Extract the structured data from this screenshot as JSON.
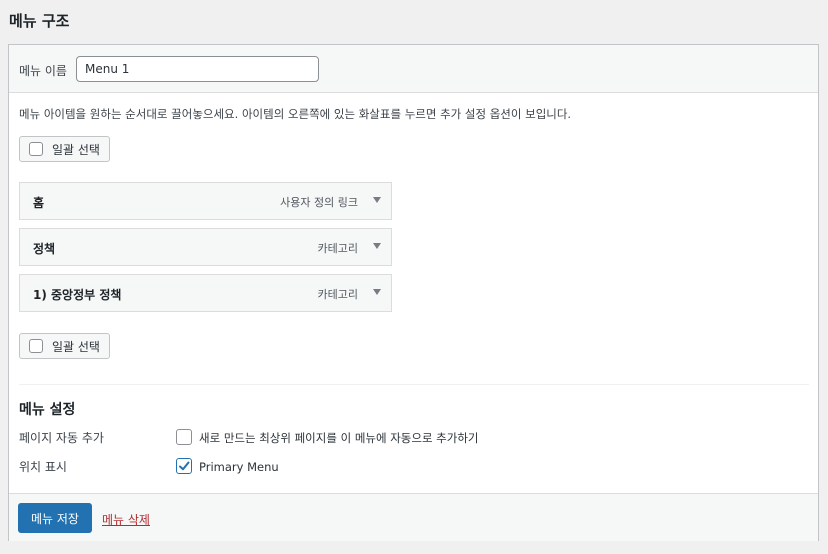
{
  "page": {
    "title": "메뉴 구조"
  },
  "menu_name": {
    "label": "메뉴 이름",
    "value": "Menu 1"
  },
  "instructions": "메뉴 아이템을 원하는 순서대로 끌어놓으세요. 아이템의 오른쪽에 있는 화살표를 누르면 추가 설정 옵션이 보입니다.",
  "bulk_select": {
    "label": "일괄 선택"
  },
  "menu_items": [
    {
      "title": "홈",
      "type": "사용자 정의 링크"
    },
    {
      "title": "정책",
      "type": "카테고리"
    },
    {
      "title": "1) 중앙정부 정책",
      "type": "카테고리"
    }
  ],
  "settings": {
    "title": "메뉴 설정",
    "auto_add": {
      "label": "페이지 자동 추가",
      "option": "새로 만드는 최상위 페이지를 이 메뉴에 자동으로 추가하기",
      "checked": false
    },
    "location": {
      "label": "위치 표시",
      "option": "Primary Menu",
      "checked": true
    }
  },
  "footer": {
    "save_label": "메뉴 저장",
    "delete_label": "메뉴 삭제"
  },
  "colors": {
    "accent": "#2271b1",
    "danger": "#b32d2e"
  }
}
